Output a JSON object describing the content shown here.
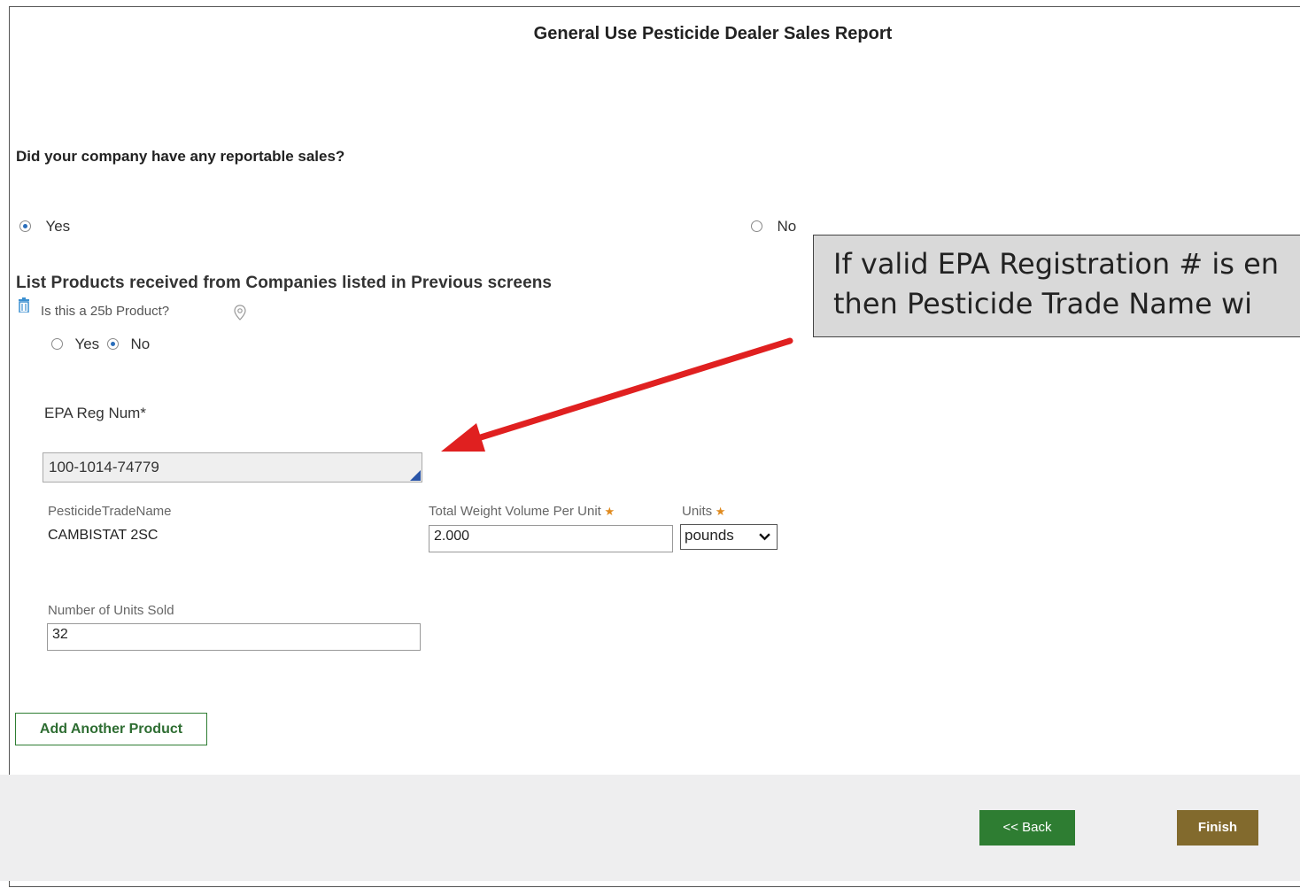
{
  "page": {
    "title": "General Use Pesticide Dealer Sales Report"
  },
  "sales_question": {
    "label": "Did your company have any reportable sales?",
    "options": [
      {
        "label": "Yes",
        "selected": true
      },
      {
        "label": "No",
        "selected": false
      }
    ]
  },
  "products_section": {
    "heading": "List Products received from Companies listed in Previous screens",
    "product_25b_question": "Is this a 25b Product?",
    "product_25b_options": [
      {
        "label": "Yes",
        "selected": false
      },
      {
        "label": "No",
        "selected": true
      }
    ],
    "epa_reg_label": "EPA Reg Num*",
    "epa_reg_value": "100-1014-74779",
    "trade_name_label": "PesticideTradeName",
    "trade_name_value": "CAMBISTAT 2SC",
    "weight_label": "Total Weight Volume Per Unit",
    "weight_value": "2.000",
    "units_label": "Units",
    "units_value": "pounds",
    "units_sold_label": "Number of Units Sold",
    "units_sold_value": "32",
    "add_product_label": "Add Another Product"
  },
  "navigation": {
    "back_label": "<< Back",
    "finish_label": "Finish"
  },
  "callout": {
    "line1": "If valid EPA Registration # is en",
    "line2": "then Pesticide Trade Name wi"
  },
  "icons": {
    "delete": "trash-icon",
    "info": "location-pin-icon",
    "dropdown": "chevron-down-icon"
  },
  "colors": {
    "accent_green": "#2e7d32",
    "finish_brown": "#826a2d",
    "radio_blue": "#2a6ebb",
    "required_star": "#e08a1e",
    "arrow_red": "#e02020",
    "callout_bg": "#d9d9d9"
  }
}
